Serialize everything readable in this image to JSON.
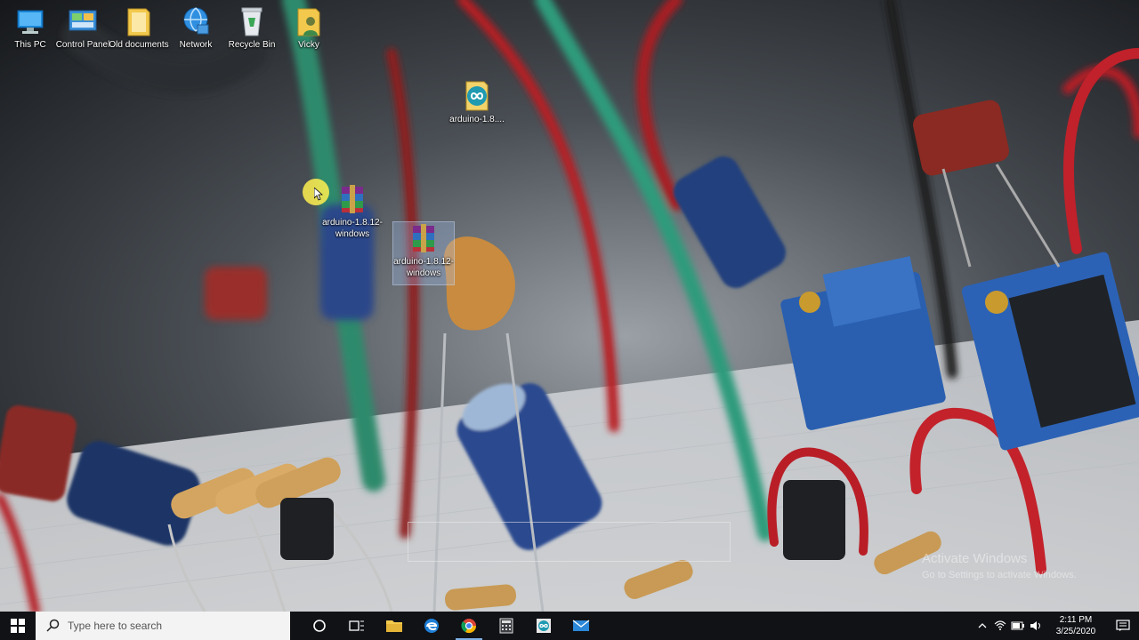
{
  "desktop": {
    "icons": [
      {
        "label": "This PC",
        "icon": "this-pc-icon"
      },
      {
        "label": "Control Panel",
        "icon": "control-panel-icon"
      },
      {
        "label": "Old documents",
        "icon": "folder-icon"
      },
      {
        "label": "Network",
        "icon": "network-icon"
      },
      {
        "label": "Recycle Bin",
        "icon": "recycle-bin-icon"
      },
      {
        "label": "Vicky",
        "icon": "user-folder-icon"
      },
      {
        "label": "arduino-1.8....",
        "icon": "arduino-app-icon"
      },
      {
        "label": "arduino-1.8.12-windows",
        "icon": "winrar-archive-icon"
      },
      {
        "label": "arduino-1.8.12-windows",
        "icon": "winrar-archive-icon"
      }
    ]
  },
  "watermark": {
    "title": "Activate Windows",
    "subtitle": "Go to Settings to activate Windows."
  },
  "taskbar": {
    "search_placeholder": "Type here to search",
    "apps": [
      "cortana-icon",
      "task-view-icon",
      "file-explorer-icon",
      "edge-icon",
      "chrome-icon",
      "calculator-icon",
      "arduino-taskbar-icon",
      "mail-icon"
    ],
    "active_app": "chrome-icon",
    "clock_time": "2:11 PM",
    "clock_date": "3/25/2020"
  },
  "colors": {
    "taskbar_bg": "#101216",
    "selection": "#aac8ff",
    "cursor_halo": "#fff050"
  }
}
